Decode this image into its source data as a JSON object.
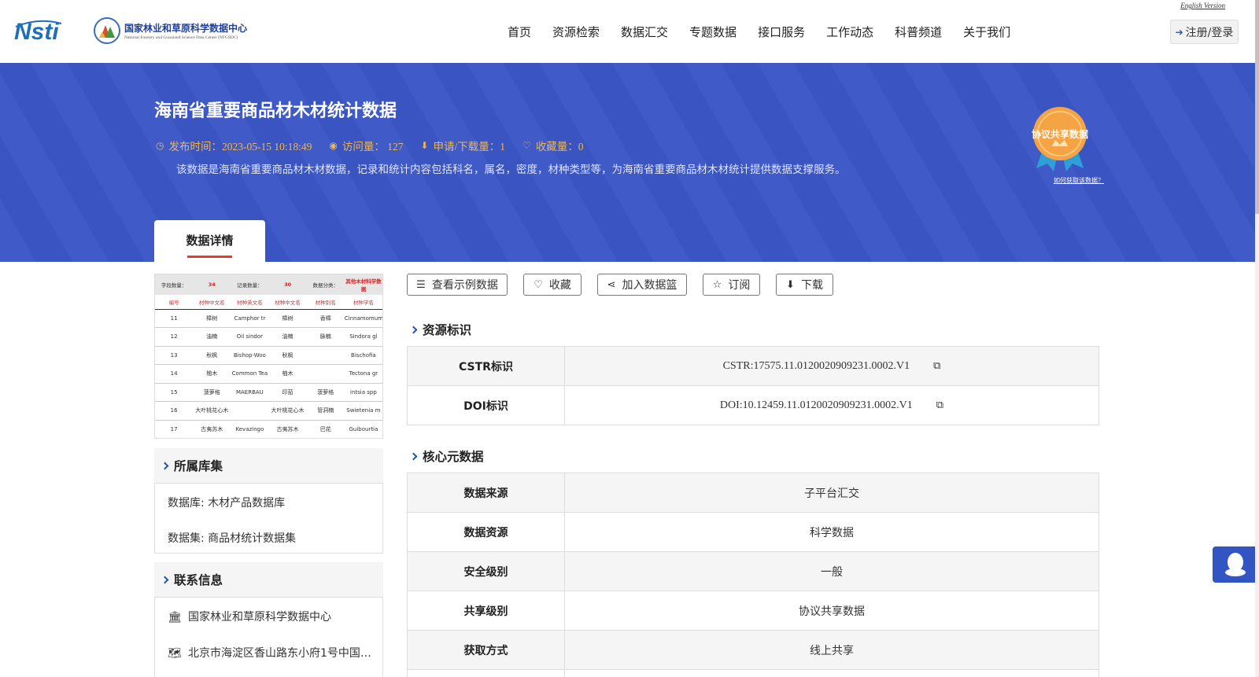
{
  "header": {
    "logo_title": "国家林业和草原科学数据中心",
    "logo_subtitle": "National Forestry and Grassland Science Data Center (NFGSDC)",
    "english_link": "English Version",
    "nav": [
      "首页",
      "资源检索",
      "数据汇交",
      "专题数据",
      "接口服务",
      "工作动态",
      "科普频道",
      "关于我们"
    ],
    "login_label": "注册/登录"
  },
  "banner": {
    "title": "海南省重要商品材木材统计数据",
    "publish": "发布时间：2023-05-15 10:18:49",
    "visits": "访问量： 127",
    "downloads": "申请/下载量：1",
    "favorites": "收藏量：0",
    "description": "该数据是海南省重要商品材木材数据，记录和统计内容包括科名，属名，密度，材种类型等，为海南省重要商品材木材统计提供数据支撑服务。",
    "badge_text": "协议共享数据",
    "badge_link": "如何获取该数据？",
    "tab_label": "数据详情"
  },
  "preview": {
    "field_count_label": "字段数量：",
    "field_count": "34",
    "record_count_label": "记录数量：",
    "record_count": "30",
    "category_label": "数据分类：",
    "category": "其他木材科学数据",
    "columns": [
      "编号",
      "材种中文名",
      "材种英文名",
      "材种中文名",
      "材种别名",
      "材种学名"
    ],
    "rows": [
      [
        "11",
        "樟树",
        "Camphor tr",
        "樟树",
        "香樟",
        "Cinnamomum"
      ],
      [
        "12",
        "油楠",
        "Oil sindor",
        "油楠",
        "脉楠",
        "Sindora gl"
      ],
      [
        "13",
        "秋枫",
        "Bishop-Woo",
        "秋枫",
        "",
        "Bischofia"
      ],
      [
        "14",
        "柚木",
        "Common Tea",
        "柚木",
        "",
        "Tectona gr"
      ],
      [
        "15",
        "菠萝格",
        "MAERBAU",
        "印茄",
        "菠萝格",
        "intsia spp"
      ],
      [
        "16",
        "大叶桃花心木",
        "",
        "大叶桃花心木",
        "管洞楠",
        "Swietenia m"
      ],
      [
        "17",
        "古夷苏木",
        "Kevazingo",
        "古夷苏木",
        "巴花",
        "Guibourtia"
      ]
    ]
  },
  "library": {
    "title": "所属库集",
    "database": "数据库: 木材产品数据库",
    "dataset": "数据集: 商品材统计数据集"
  },
  "contact": {
    "title": "联系信息",
    "org": "国家林业和草原科学数据中心",
    "address": "北京市海淀区香山路东小府1号中国…"
  },
  "actions": {
    "sample": "查看示例数据",
    "favorite": "收藏",
    "basket": "加入数据篮",
    "subscribe": "订阅",
    "download": "下载"
  },
  "identity": {
    "title": "资源标识",
    "cstr_label": "CSTR标识",
    "cstr_value": "CSTR:17575.11.0120020909231.0002.V1",
    "doi_label": "DOI标识",
    "doi_value": "DOI:10.12459.11.0120020909231.0002.V1"
  },
  "core": {
    "title": "核心元数据",
    "rows": [
      {
        "k": "数据来源",
        "v": "子平台汇交"
      },
      {
        "k": "数据资源",
        "v": "科学数据"
      },
      {
        "k": "安全级别",
        "v": "一般"
      },
      {
        "k": "共享级别",
        "v": "协议共享数据"
      },
      {
        "k": "获取方式",
        "v": "线上共享"
      }
    ]
  }
}
